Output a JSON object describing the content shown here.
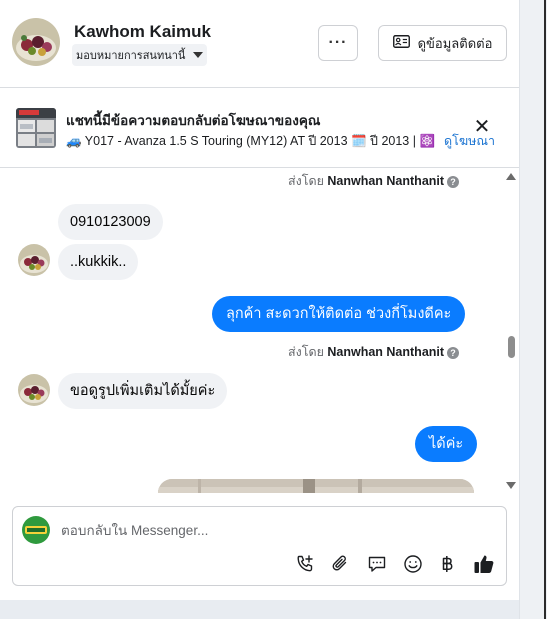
{
  "header": {
    "name": "Kawhom Kaimuk",
    "assign_label": "มอบหมายการสนทนานี้",
    "more_label": "···",
    "contact_label": "ดูข้อมูลติดต่อ"
  },
  "ad": {
    "title": "แชทนี้มีข้อความตอบกลับต่อโฆษณาของคุณ",
    "subtitle": "🚙 Y017 - Avanza 1.5 S Touring (MY12) AT ปี 2013 🗓️ ปี 2013 | ⚛️ เ...",
    "view_ad_label": "ดูโฆษณา",
    "close_label": "✕"
  },
  "messages": {
    "sent_by_prefix": "ส่งโดย",
    "sent_by_name": "Nanwhan Nanthanit",
    "info_glyph": "?",
    "items": [
      {
        "direction": "in",
        "text": "0910123009"
      },
      {
        "direction": "in",
        "text": "..kukkik.."
      },
      {
        "direction": "out",
        "text": "ลุกค้า  สะดวกให้ติดต่อ ช่วงกี่โมงดีคะ"
      },
      {
        "direction": "in",
        "text": "ขอดูรูปเพิ่มเติมได้มั้ยค่ะ"
      },
      {
        "direction": "out",
        "text": "ได้ค่ะ"
      }
    ]
  },
  "composer": {
    "placeholder": "ตอบกลับใน Messenger...",
    "tools": [
      "phone-add-icon",
      "paperclip-icon",
      "chat-bubble-icon",
      "smiley-icon",
      "baht-icon",
      "thumbs-up-icon"
    ]
  },
  "colors": {
    "accent": "#0a7cff",
    "link": "#1a73d1",
    "incoming_bubble": "#f0f2f5"
  }
}
